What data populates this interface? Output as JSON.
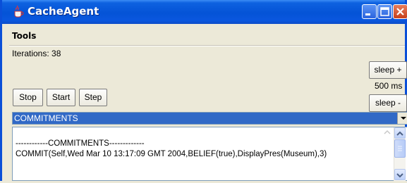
{
  "window": {
    "title": "CacheAgent"
  },
  "menu": {
    "tools": "Tools"
  },
  "status": {
    "iterations": "Iterations: 38"
  },
  "controls": {
    "stop": "Stop",
    "start": "Start",
    "step": "Step",
    "sleep_plus": "sleep +",
    "sleep_value": "500 ms",
    "sleep_minus": "sleep -"
  },
  "view_select": {
    "selected": "COMMITMENTS"
  },
  "output": {
    "lines": [
      "------------COMMITMENTS-------------",
      "COMMIT(Self,Wed Mar 10 13:17:09 GMT 2004,BELIEF(true),DisplayPres(Museum),3)"
    ]
  },
  "colors": {
    "titlebar": "#0453d6",
    "selection": "#3169c6",
    "close": "#c6401c"
  }
}
